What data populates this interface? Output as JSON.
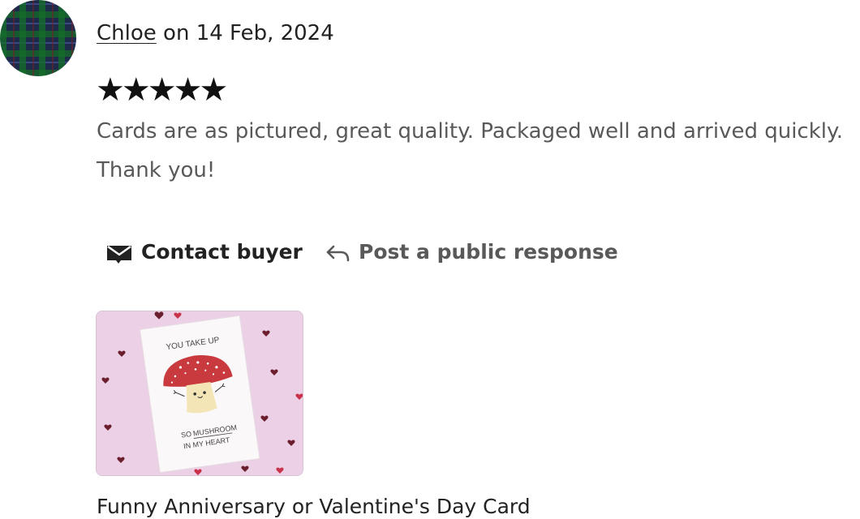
{
  "review": {
    "author": "Chloe",
    "date_prefix": "on",
    "date": "14 Feb, 2024",
    "rating": 5,
    "stars": "★★★★★",
    "text": "Cards are as pictured, great quality. Packaged well and arrived quickly. Thank you!"
  },
  "actions": {
    "contact_label": "Contact buyer",
    "contact_icon": "envelope-icon",
    "respond_label": "Post a public response",
    "respond_icon": "reply-arrow-icon"
  },
  "listing": {
    "title": "Funny Anniversary or Valentine's Day Card",
    "image_text": {
      "line1": "YOU TAKE UP",
      "line2_prefix": "SO",
      "line2_word": "MUSHROOM",
      "line3": "IN MY HEART"
    }
  },
  "colors": {
    "text_dark": "#222222",
    "text_muted": "#595959",
    "image_background": "#ecd0e6",
    "mushroom_cap": "#c83a3d",
    "heart_dark": "#6b1f2e"
  }
}
